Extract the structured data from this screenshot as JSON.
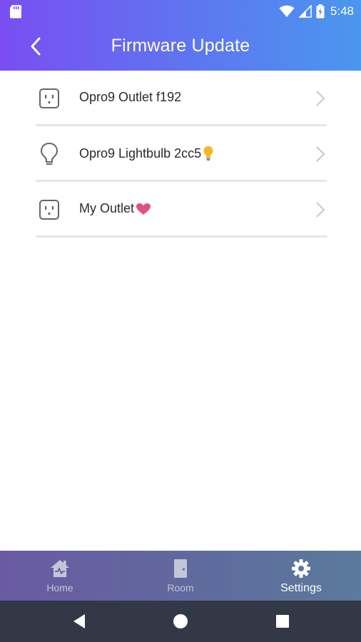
{
  "status_bar": {
    "time": "5:48",
    "icons": [
      "sd-card-icon",
      "wifi-icon",
      "signal-icon",
      "battery-icon"
    ]
  },
  "header": {
    "title": "Firmware Update",
    "back_icon": "chevron-left-icon",
    "gradient": [
      "#7a4ef2",
      "#4a97ee"
    ]
  },
  "devices": [
    {
      "label": "Opro9 Outlet f192",
      "icon": "outlet-icon",
      "emoji": ""
    },
    {
      "label": "Opro9 Lightbulb 2cc5",
      "icon": "lightbulb-icon",
      "emoji": "💡"
    },
    {
      "label": "My Outlet",
      "icon": "outlet-icon",
      "emoji": "❤"
    }
  ],
  "tabbar": {
    "tabs": [
      {
        "label": "Home",
        "icon": "home-icon",
        "active": false
      },
      {
        "label": "Room",
        "icon": "door-icon",
        "active": false
      },
      {
        "label": "Settings",
        "icon": "gear-icon",
        "active": true
      }
    ]
  },
  "system_nav": {
    "buttons": [
      "back-triangle-icon",
      "home-circle-icon",
      "recents-square-icon"
    ]
  },
  "colors": {
    "divider": "#e6e6e6",
    "text": "#2b2b2b",
    "heart": "#e0508a",
    "bulb_emoji": "#f5b820",
    "navbar": "#323846"
  }
}
